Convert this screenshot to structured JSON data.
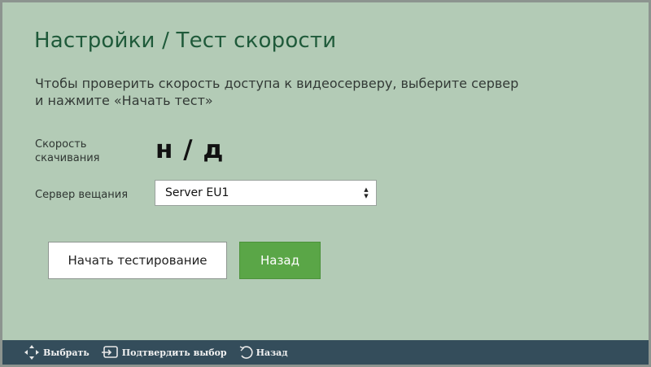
{
  "header": {
    "title": "Настройки / Тест скорости"
  },
  "instructions": "Чтобы проверить скорость доступа к видеосерверу, выберите сервер и нажмите «Начать тест»",
  "speed": {
    "label": "Скорость скачивания",
    "value": "н / д"
  },
  "server": {
    "label": "Сервер вещания",
    "selected": "Server EU1"
  },
  "buttons": {
    "start": "Начать тестирование",
    "back": "Назад"
  },
  "bottom_bar": {
    "hints": [
      {
        "icon": "dpad-icon",
        "label": "Выбрать"
      },
      {
        "icon": "enter-icon",
        "label": "Подтвердить выбор"
      },
      {
        "icon": "back-arrow-icon",
        "label": "Назад"
      }
    ]
  },
  "colors": {
    "background": "#b3cbb6",
    "accent_green": "#5aa647",
    "title": "#1f5a3a",
    "bottom_bar": "#344d5b"
  }
}
